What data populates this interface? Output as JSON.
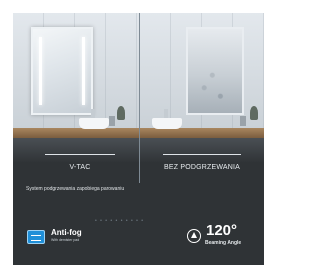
{
  "comparison": {
    "left_label": "V-TAC",
    "right_label": "BEZ PODGRZEWANIA"
  },
  "description": "System podgrzewania zapobiega parowaniu",
  "pagination_dots": "• • • • • • • • • •",
  "features": {
    "antifog": {
      "icon": "antifog-icon",
      "title": "Anti-fog",
      "subtitle": "With demister pad"
    },
    "angle": {
      "icon": "beam-angle-icon",
      "value": "120°",
      "subtitle": "Beaming Angle"
    }
  },
  "colors": {
    "card_background": "#2f3336",
    "accent_blue": "#1f8fd8",
    "text_light": "#ffffff"
  }
}
